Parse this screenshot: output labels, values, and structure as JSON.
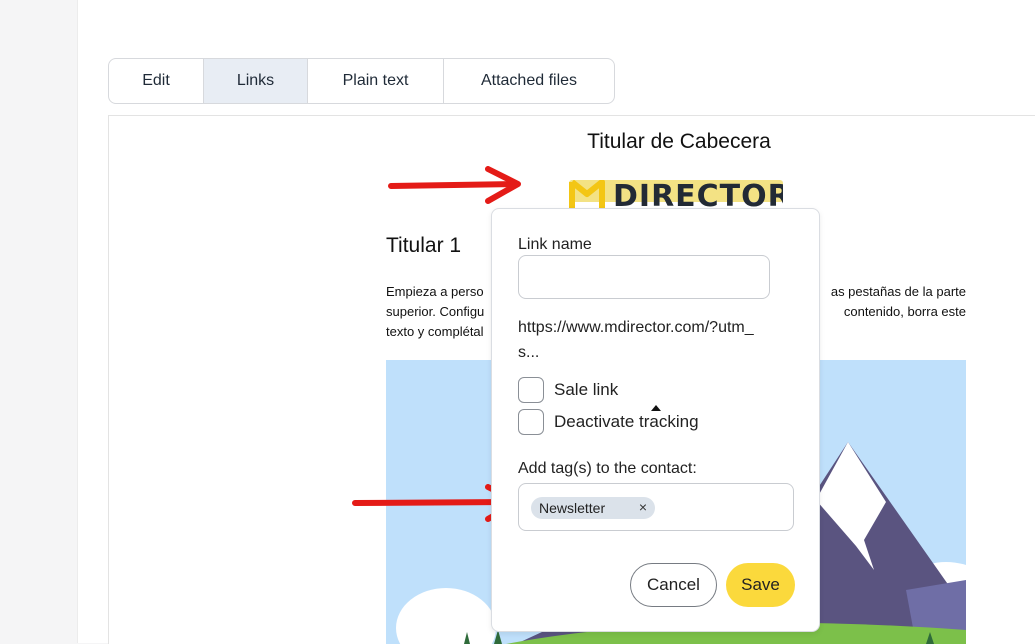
{
  "tabs": [
    {
      "label": "Edit",
      "active": false
    },
    {
      "label": "Links",
      "active": true
    },
    {
      "label": "Plain text",
      "active": false
    },
    {
      "label": "Attached files",
      "active": false
    }
  ],
  "preview": {
    "header_title": "Titular de Cabecera",
    "logo_text": "DIRECTOR",
    "titular": "Titular 1",
    "body_lines": [
      "Empieza a perso",
      "as pestañas de la parte",
      "superior. Configu",
      "contenido, borra este",
      "texto y complétal"
    ]
  },
  "popover": {
    "link_name_label": "Link name",
    "link_name_value": "",
    "url_text": "https://www.mdirector.com/?utm_s...",
    "sale_link_label": "Sale link",
    "deactivate_tracking_label": "Deactivate tracking",
    "tags_label": "Add tag(s) to the contact:",
    "tags": [
      "Newsletter"
    ],
    "chip_remove": "×",
    "cancel_label": "Cancel",
    "save_label": "Save"
  },
  "colors": {
    "accent_save": "#fbd93c",
    "tab_active_bg": "#e8edf4",
    "annotation_arrow": "#e41b17",
    "sky": "#bfe0fb"
  }
}
